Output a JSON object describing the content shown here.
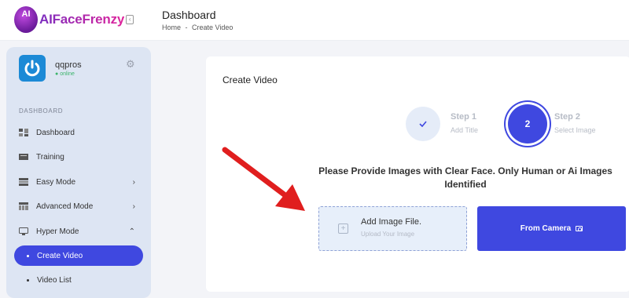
{
  "brand": {
    "badge": "AI",
    "name": "AIFaceFrenzy",
    "collapse_icon": "collapse-sidebar-icon"
  },
  "header": {
    "title": "Dashboard",
    "breadcrumb": [
      "Home",
      "Create Video"
    ],
    "separator": "-"
  },
  "user": {
    "name": "qqpros",
    "status": "online",
    "avatar_icon": "power-icon",
    "settings_icon": "gear-icon"
  },
  "sidebar": {
    "section": "DASHBOARD",
    "items": [
      {
        "label": "Dashboard",
        "icon": "dashboard-icon"
      },
      {
        "label": "Training",
        "icon": "training-icon"
      },
      {
        "label": "Easy Mode",
        "icon": "easy-mode-icon",
        "chevron": "›"
      },
      {
        "label": "Advanced Mode",
        "icon": "advanced-mode-icon",
        "chevron": "›"
      },
      {
        "label": "Hyper Mode",
        "icon": "hyper-mode-icon",
        "chevron": "⌃"
      },
      {
        "label": "Create Video",
        "active": true
      },
      {
        "label": "Video List"
      }
    ]
  },
  "main": {
    "title": "Create Video",
    "steps": [
      {
        "icon": "checkmark-icon",
        "title": "Step 1",
        "subtitle": "Add Title"
      },
      {
        "number": "2",
        "title": "Step 2",
        "subtitle": "Select Image"
      }
    ],
    "notice": "Please Provide Images with Clear Face. Only Human or Ai Images Identified",
    "upload": {
      "title": "Add Image File.",
      "subtitle": "Upload Your Image",
      "icon": "plus-icon"
    },
    "camera": {
      "label": "From Camera",
      "icon": "camera-icon"
    }
  },
  "colors": {
    "accent": "#3f48e0",
    "annotation_arrow": "#e01e1e",
    "brand_purple": "#7b2cbf",
    "brand_pink": "#e0249b"
  }
}
